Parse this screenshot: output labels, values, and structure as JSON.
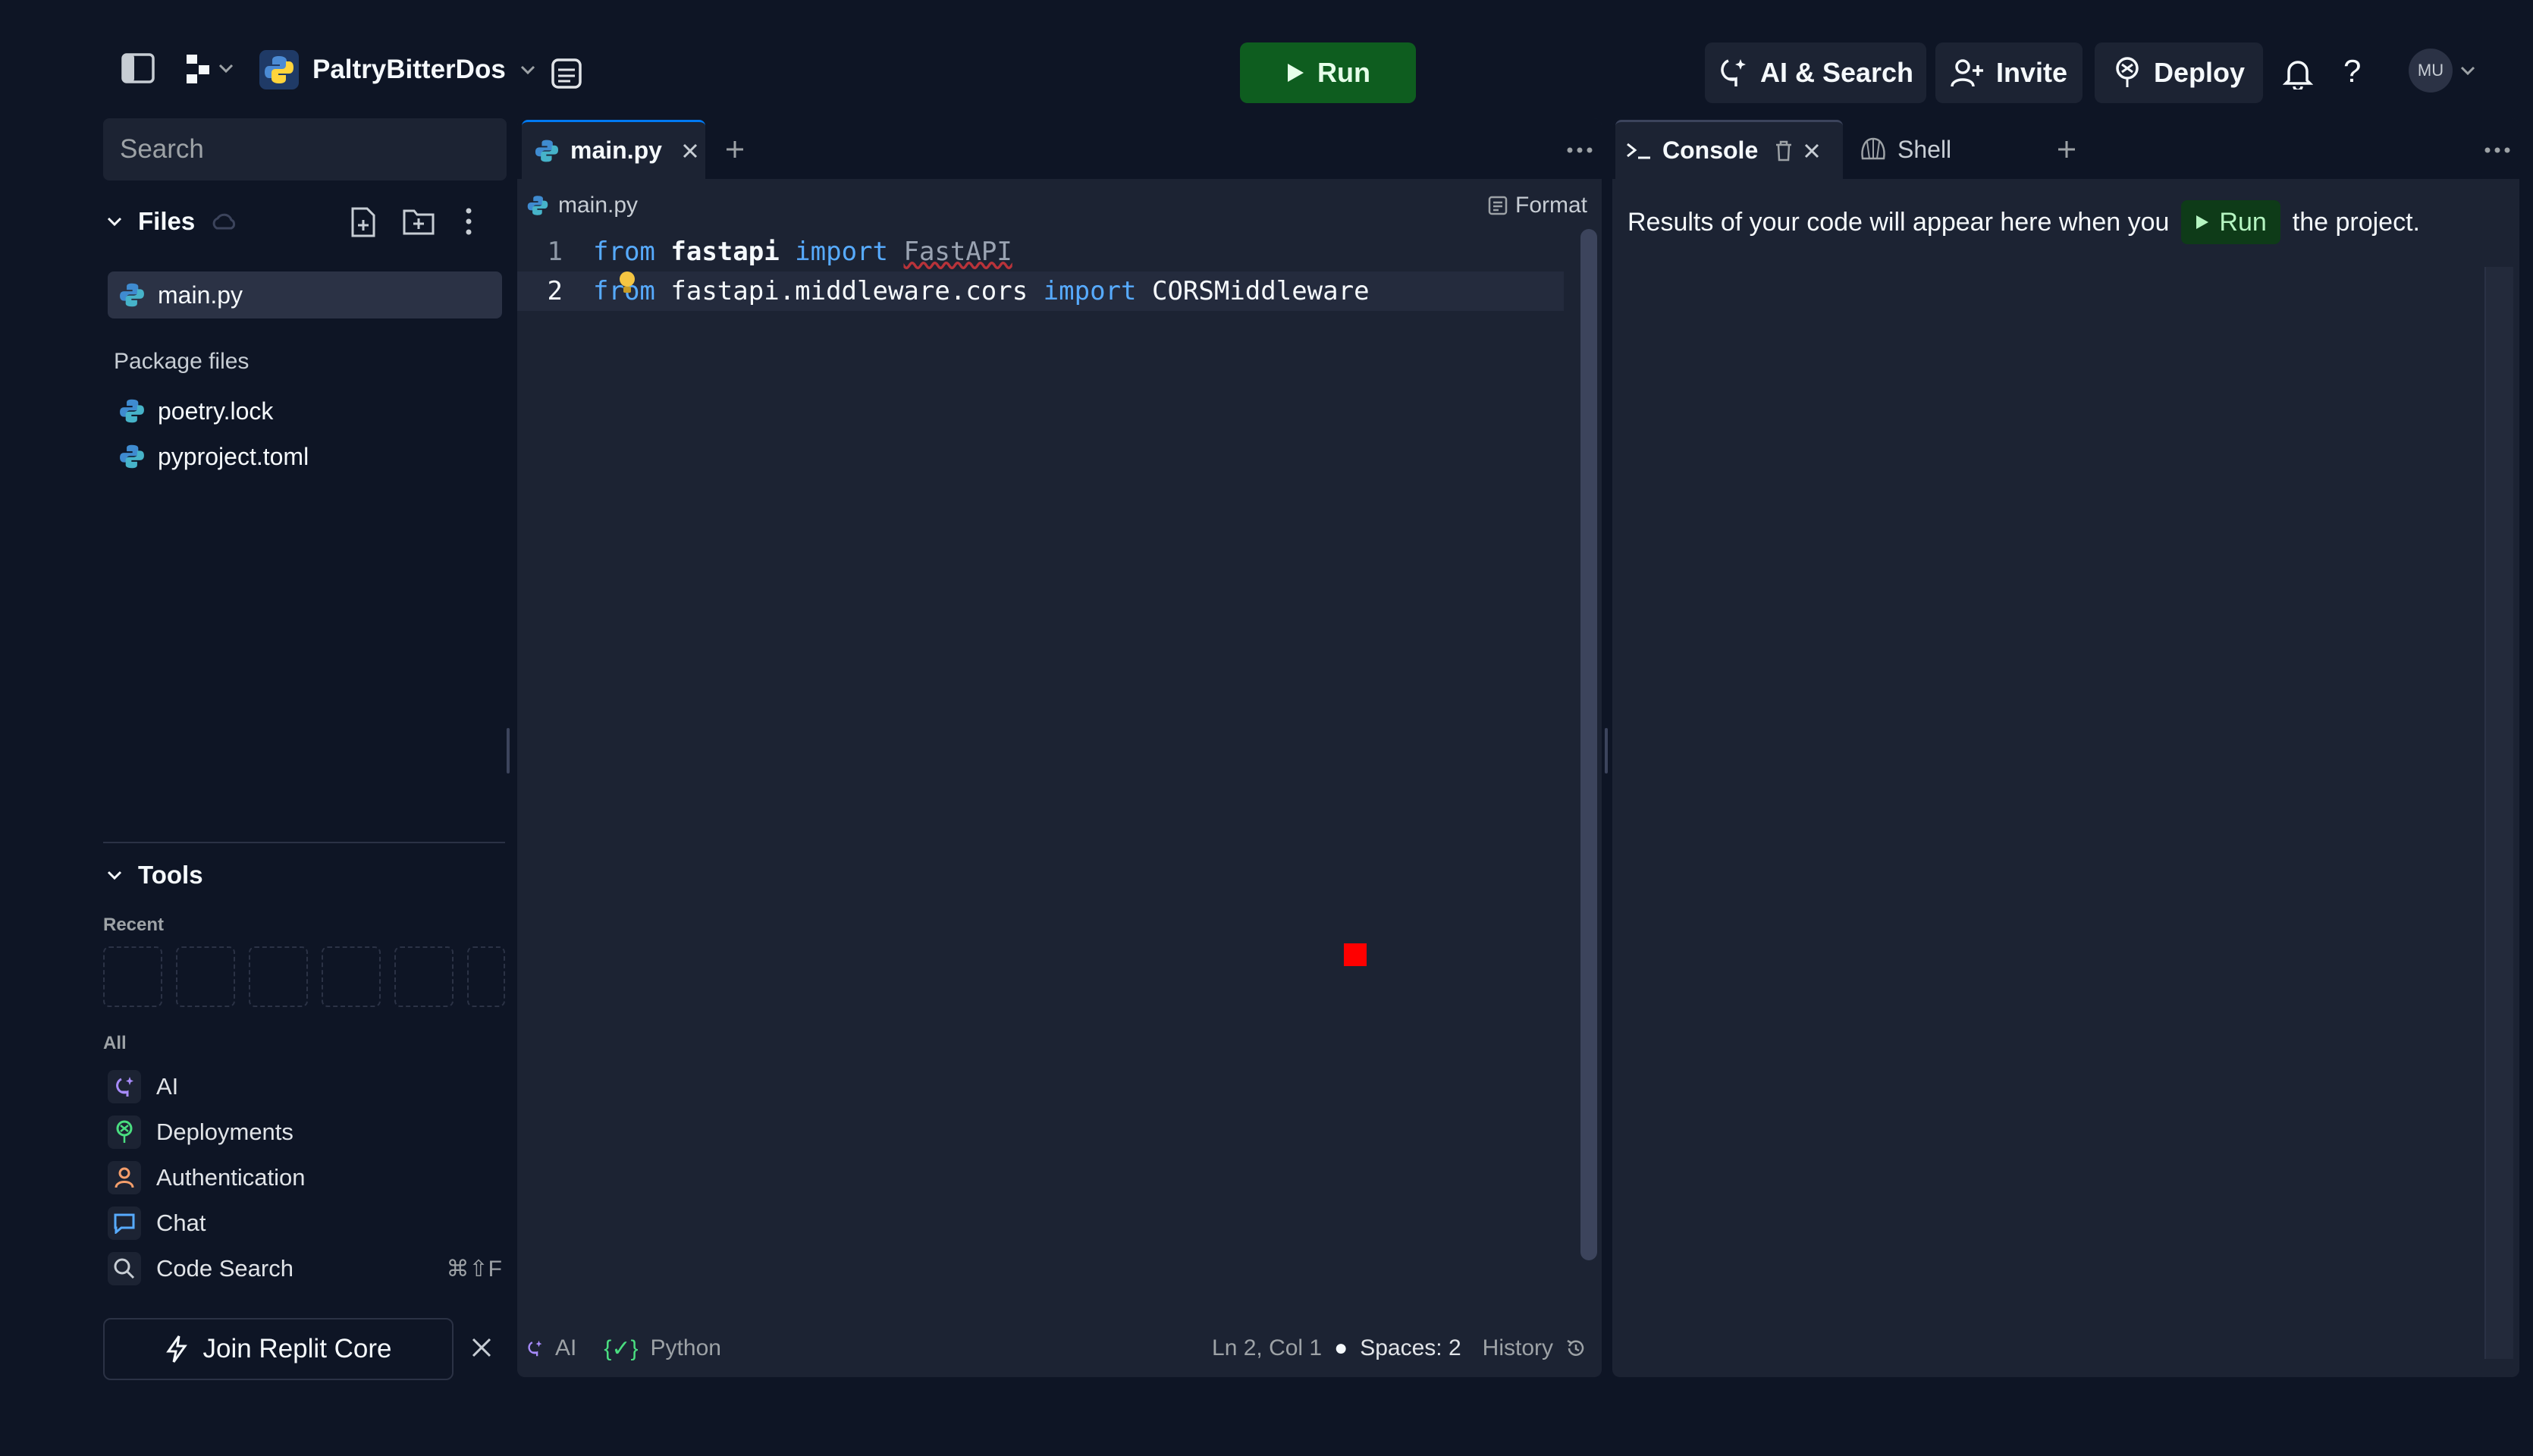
{
  "topbar": {
    "project_name": "PaltryBitterDos",
    "run_label": "Run",
    "ai_search_label": "AI & Search",
    "invite_label": "Invite",
    "deploy_label": "Deploy",
    "help_label": "?",
    "avatar_initials": "MU"
  },
  "sidebar": {
    "search_placeholder": "Search",
    "files_title": "Files",
    "files": [
      {
        "name": "main.py"
      }
    ],
    "package_files_title": "Package files",
    "package_files": [
      {
        "name": "poetry.lock"
      },
      {
        "name": "pyproject.toml"
      }
    ],
    "tools_title": "Tools",
    "recent_label": "Recent",
    "all_label": "All",
    "tools": [
      {
        "label": "AI",
        "icon": "ai-icon"
      },
      {
        "label": "Deployments",
        "icon": "deploy-icon"
      },
      {
        "label": "Authentication",
        "icon": "user-icon"
      },
      {
        "label": "Chat",
        "icon": "chat-icon"
      },
      {
        "label": "Code Search",
        "icon": "search-icon",
        "shortcut": "⌘⇧F"
      }
    ],
    "join_core_label": "Join Replit Core"
  },
  "editor": {
    "tab_label": "main.py",
    "breadcrumb": "main.py",
    "format_label": "Format",
    "lines": [
      {
        "number": "1",
        "kw1": "from",
        "mod": "fastapi",
        "kw2": "import",
        "name": "FastAPI"
      },
      {
        "number": "2",
        "kw1": "from",
        "mod": "fastapi.middleware.cors",
        "kw2": "import",
        "name": "CORSMiddleware"
      }
    ],
    "status": {
      "ai_label": "AI",
      "language": "Python",
      "cursor": "Ln 2, Col 1",
      "spaces": "Spaces: 2",
      "history": "History"
    }
  },
  "console": {
    "console_tab_label": "Console",
    "shell_tab_label": "Shell",
    "message_before": "Results of your code will appear here when you",
    "run_label": "Run",
    "message_after": "the project."
  },
  "colors": {
    "background": "#0e1525",
    "panel": "#1c2333",
    "run_green": "#0e5d1f",
    "keyword_blue": "#57abff"
  }
}
